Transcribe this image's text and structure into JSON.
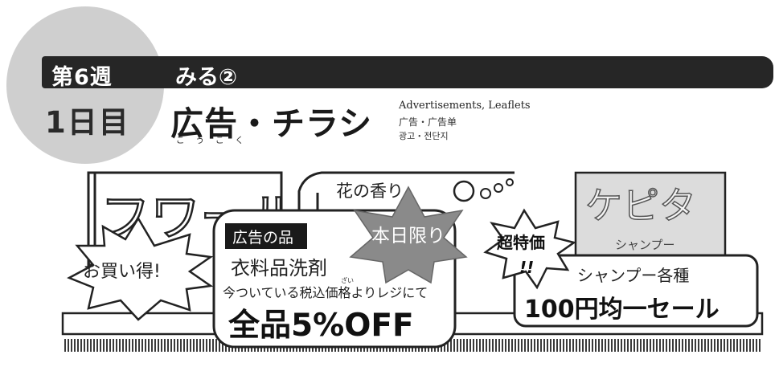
{
  "header": {
    "week_label": "第6週",
    "topic_label": "みる②",
    "day_label": "1日目",
    "title": "広告・チラシ",
    "title_reading": [
      "こ",
      "う",
      "こ",
      "く"
    ],
    "subtitle_en": "Advertisements, Leaflets",
    "subtitle_zh": "广告・广告单",
    "subtitle_ko": "광고・전단지"
  },
  "illustration": {
    "shelf_items": {
      "left_bottle": "フワール",
      "center_bottle": "花の香り",
      "right_bottle": "ケピタ",
      "right_bottle_sub": "シャンプー"
    },
    "burst_left": "お買い得!",
    "sign_center": {
      "tag": "広告の品",
      "item": "衣料品洗剤",
      "item_reading": "ざい",
      "desc": "今ついている税込価格よりレジにて",
      "deal": "全品5%OFF"
    },
    "burst_center": "本日限り",
    "burst_right": "超特価",
    "burst_right_mark": "!!",
    "sign_right": {
      "item": "シャンプー各種",
      "deal": "100円均一セール"
    }
  },
  "colors": {
    "circle": "#cfcfcf",
    "bar": "#262626",
    "star": "#8a8a8a",
    "shelf": "#dcdcdc"
  }
}
